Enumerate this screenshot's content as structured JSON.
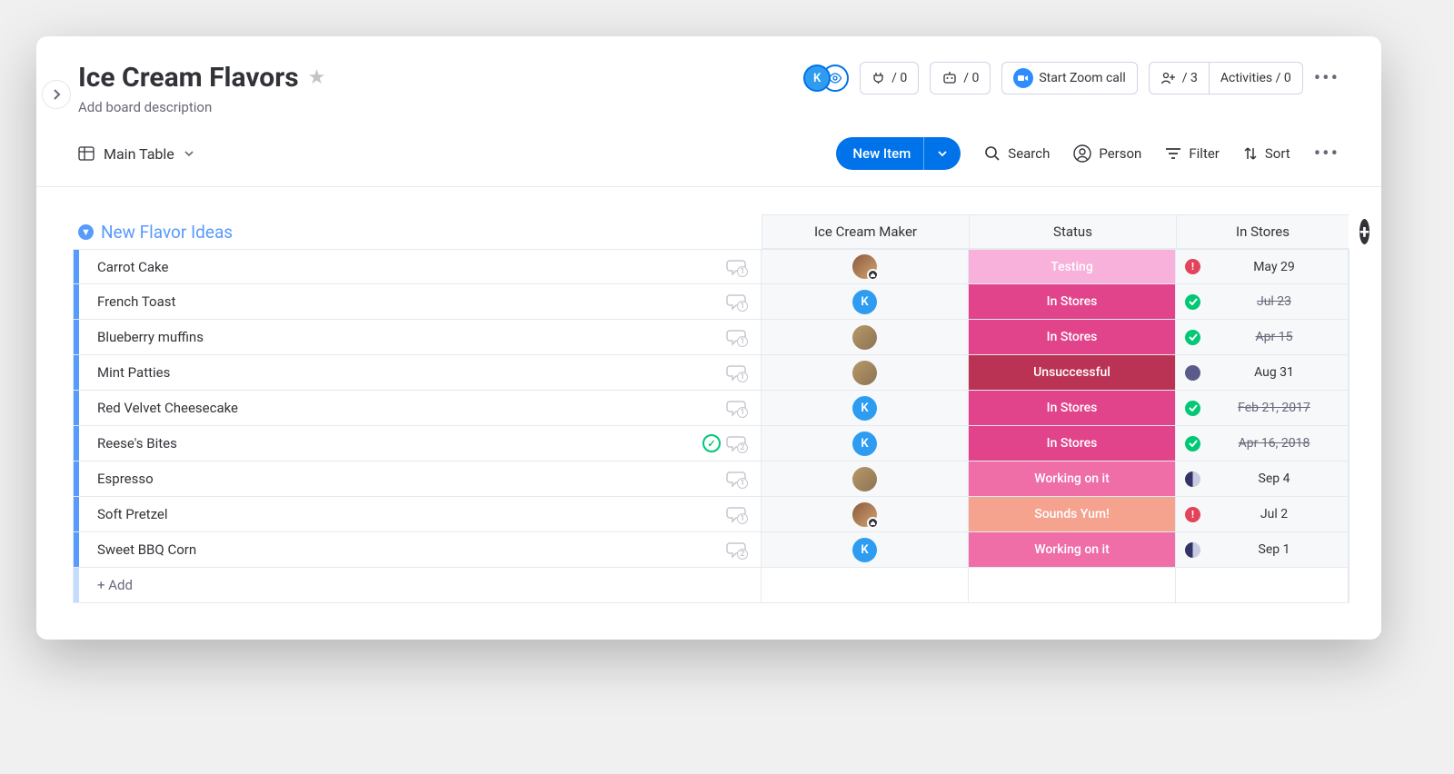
{
  "header": {
    "title": "Ice Cream Flavors",
    "description": "Add board description",
    "pins_count": "/ 0",
    "automations_count": "/ 0",
    "zoom_label": "Start Zoom call",
    "invite_count": "/ 3",
    "activities_label": "Activities / 0"
  },
  "toolbar": {
    "view_name": "Main Table",
    "new_item_label": "New Item",
    "search_label": "Search",
    "person_label": "Person",
    "filter_label": "Filter",
    "sort_label": "Sort"
  },
  "group": {
    "title": "New Flavor Ideas",
    "columns": {
      "maker": "Ice Cream Maker",
      "status": "Status",
      "in_stores": "In Stores"
    },
    "add_label": "+ Add"
  },
  "statuses": {
    "Testing": "#f8b1db",
    "In Stores": "#e2448c",
    "Unsuccessful": "#bb3354",
    "Working on it": "#ef6ea8",
    "Sounds Yum!": "#f5a28f"
  },
  "date_indicators": {
    "alert": "#e2445c",
    "done": "#00c875",
    "dark": "#5b5b8a",
    "half": "#5b5b8a"
  },
  "items": [
    {
      "name": "Carrot Cake",
      "maker": "photo1",
      "chat": 1,
      "status": "Testing",
      "date": "May 29",
      "date_ind": "alert",
      "strike": false
    },
    {
      "name": "French Toast",
      "maker": "k",
      "chat": 1,
      "status": "In Stores",
      "date": "Jul 23",
      "date_ind": "done",
      "strike": true
    },
    {
      "name": "Blueberry muffins",
      "maker": "photo2",
      "chat": 1,
      "status": "In Stores",
      "date": "Apr 15",
      "date_ind": "done",
      "strike": true
    },
    {
      "name": "Mint Patties",
      "maker": "photo2",
      "chat": 1,
      "status": "Unsuccessful",
      "date": "Aug 31",
      "date_ind": "dark",
      "strike": false
    },
    {
      "name": "Red Velvet Cheesecake",
      "maker": "k",
      "chat": 1,
      "status": "In Stores",
      "date": "Feb 21, 2017",
      "date_ind": "done",
      "strike": true
    },
    {
      "name": "Reese's Bites",
      "maker": "k",
      "chat": 2,
      "check": true,
      "status": "In Stores",
      "date": "Apr 16, 2018",
      "date_ind": "done",
      "strike": true
    },
    {
      "name": "Espresso",
      "maker": "photo2",
      "chat": 1,
      "status": "Working on it",
      "date": "Sep 4",
      "date_ind": "half",
      "strike": false
    },
    {
      "name": "Soft Pretzel",
      "maker": "photo1",
      "chat": 1,
      "status": "Sounds Yum!",
      "date": "Jul 2",
      "date_ind": "alert",
      "strike": false
    },
    {
      "name": "Sweet BBQ Corn",
      "maker": "k",
      "chat": 2,
      "status": "Working on it",
      "date": "Sep 1",
      "date_ind": "half",
      "strike": false
    }
  ]
}
